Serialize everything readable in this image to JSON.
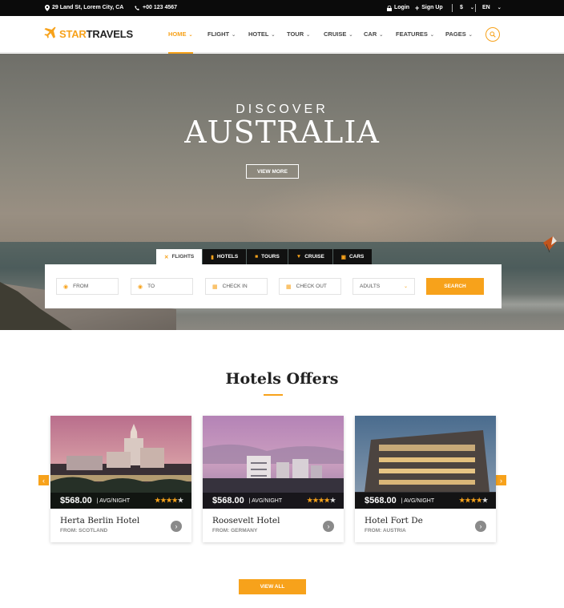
{
  "topbar": {
    "address": "29 Land St, Lorem City, CA",
    "phone": "+00 123 4567",
    "login": "Login",
    "signup": "Sign Up",
    "currency": "$",
    "language": "EN"
  },
  "brand": {
    "star": "STAR",
    "travels": "TRAVELS",
    "accent": "#f7a21b"
  },
  "nav": [
    {
      "label": "HOME"
    },
    {
      "label": "FLIGHT"
    },
    {
      "label": "HOTEL"
    },
    {
      "label": "TOUR"
    },
    {
      "label": "CRUISE"
    },
    {
      "label": "CAR"
    },
    {
      "label": "FEATURES"
    },
    {
      "label": "PAGES"
    }
  ],
  "hero": {
    "subtitle": "DISCOVER",
    "title": "AUSTRALIA",
    "button": "VIEW MORE"
  },
  "search": {
    "tabs": [
      {
        "label": "FLIGHTS",
        "icon": "plane-icon"
      },
      {
        "label": "HOTELS",
        "icon": "hotel-icon"
      },
      {
        "label": "TOURS",
        "icon": "suitcase-icon"
      },
      {
        "label": "CRUISE",
        "icon": "ship-icon"
      },
      {
        "label": "CARS",
        "icon": "car-icon"
      }
    ],
    "from": "FROM",
    "to": "TO",
    "checkin": "CHECK IN",
    "checkout": "CHECK OUT",
    "adults": "ADULTS",
    "button": "SEARCH"
  },
  "hotels": {
    "title": "Hotels Offers",
    "cards": [
      {
        "price": "$568.00",
        "per": "| AVG/NIGHT",
        "rating": 4,
        "name": "Herta Berlin Hotel",
        "from": "FROM: SCOTLAND"
      },
      {
        "price": "$568.00",
        "per": "| AVG/NIGHT",
        "rating": 4,
        "name": "Roosevelt Hotel",
        "from": "FROM: GERMANY"
      },
      {
        "price": "$568.00",
        "per": "| AVG/NIGHT",
        "rating": 4,
        "name": "Hotel Fort De",
        "from": "FROM: AUSTRIA"
      }
    ],
    "view_all": "VIEW ALL"
  }
}
